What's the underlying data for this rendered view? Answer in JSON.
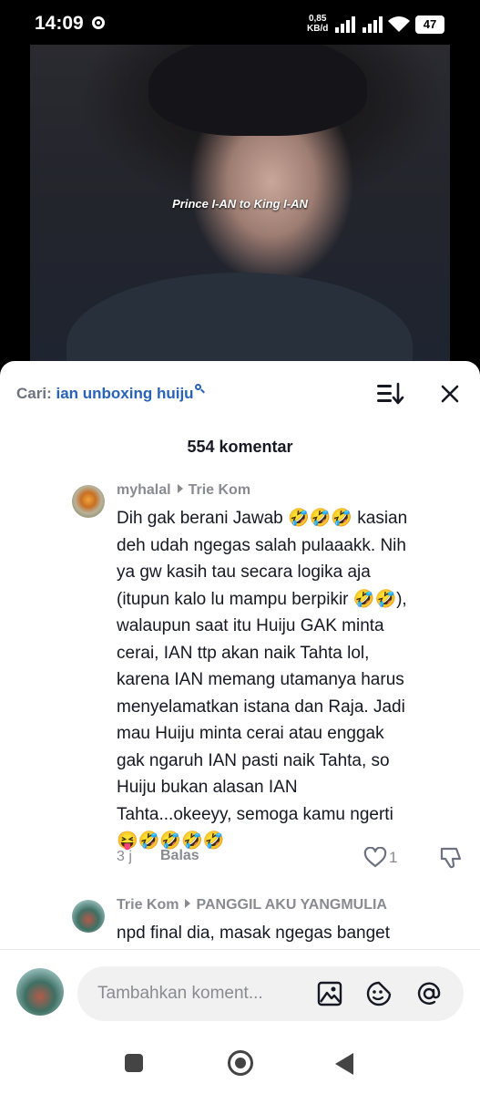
{
  "status_bar": {
    "time": "14:09",
    "net_speed_value": "0,85",
    "net_speed_unit": "KB/d",
    "battery": "47"
  },
  "video": {
    "caption": "Prince I-AN to King I-AN"
  },
  "search": {
    "prefix": "Cari:",
    "query": "ian unboxing huiju"
  },
  "comments_header": {
    "count_label": "554 komentar"
  },
  "comments": [
    {
      "user": "myhalal",
      "reply_to": "Trie Kom",
      "lines": [
        "Dih gak berani Jawab 🤣🤣🤣 kasian",
        "deh udah ngegas salah pulaaakk. Nih",
        "ya gw kasih tau secara logika aja",
        "(itupun kalo lu mampu berpikir 🤣🤣),",
        "walaupun saat itu Huiju GAK minta",
        "cerai, IAN ttp akan naik Tahta lol,",
        "karena IAN memang utamanya harus",
        "menyelamatkan istana dan Raja. Jadi",
        "mau Huiju minta cerai atau enggak",
        "gak ngaruh IAN pasti naik Tahta, so",
        "Huiju bukan alasan IAN",
        "Tahta...okeeyy, semoga kamu ngerti",
        "😝🤣🤣🤣🤣"
      ],
      "time": "3 j",
      "reply_label": "Balas",
      "likes": "1"
    },
    {
      "user": "Trie Kom",
      "reply_to": "PANGGIL AKU YANGMULIA",
      "lines": [
        "npd final dia, masak ngegas banget"
      ]
    }
  ],
  "input": {
    "placeholder": "Tambahkan koment..."
  },
  "icons": {
    "sort": "sort-icon",
    "close": "close-icon",
    "like": "heart-icon",
    "dislike": "thumbs-down-icon",
    "image": "image-icon",
    "sticker": "sticker-icon",
    "mention": "at-icon"
  }
}
